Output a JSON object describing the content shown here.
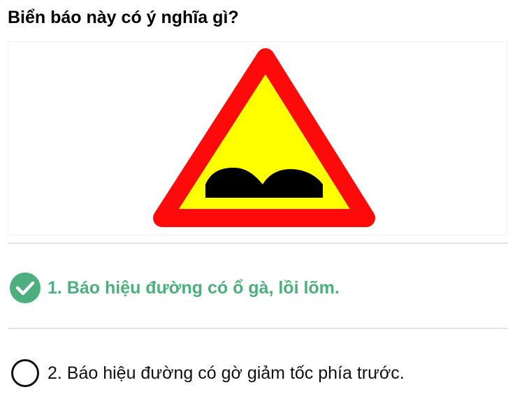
{
  "question": {
    "title": "Biển báo này có ý nghĩa gì?"
  },
  "sign_image": {
    "icon": "uneven-road-warning-sign",
    "colors": {
      "border": "#ff0a0a",
      "fill": "#ffff00",
      "bumps": "#000000"
    }
  },
  "options": [
    {
      "label": "1. Báo hiệu đường có ổ gà, lồi lõm.",
      "state": "correct",
      "icon": "check-circle-icon",
      "color": "#4caf7d"
    },
    {
      "label": "2. Báo hiệu đường có gờ giảm tốc phía trước.",
      "state": "unselected",
      "icon": "radio-circle-icon",
      "color": "#111111"
    }
  ]
}
